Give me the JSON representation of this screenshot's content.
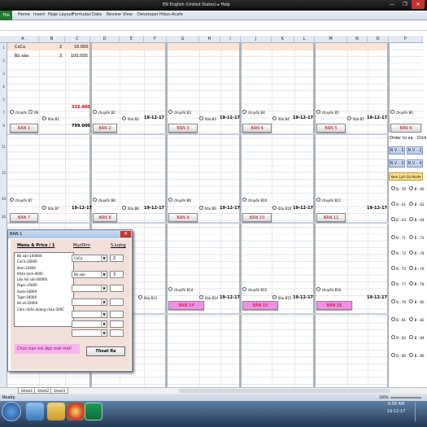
{
  "window": {
    "title": "EN English (United States) ▸ Help",
    "min": "—",
    "max": "❐",
    "close": "✕"
  },
  "ribbon": {
    "file": "File",
    "tabs": [
      "Home",
      "Insert",
      "Page Layout",
      "Formulas",
      "Data",
      "Review",
      "View",
      "Developer",
      "Hduo-Acafe"
    ]
  },
  "columns": [
    "A",
    "B",
    "C",
    "D",
    "E",
    "F",
    "G",
    "H",
    "I",
    "J",
    "K",
    "L",
    "M",
    "N",
    "O",
    "P"
  ],
  "cells": {
    "r1": {
      "a": "CoCa",
      "b": "2",
      "c": "16.000"
    },
    "r2": {
      "a": "Bò xào",
      "b": "3",
      "c": "100.000"
    },
    "total_red": "332.000",
    "total": "799.000"
  },
  "tables": {
    "row1": [
      {
        "label": "BÀN 1",
        "radio": "chuyển",
        "radio2": "Xóa B1",
        "date": "19-12-17"
      },
      {
        "label": "BÀN 2",
        "radio": "chuyển B2",
        "radio2": "Xóa B2",
        "date": "19-12-17"
      },
      {
        "label": "BÀN 3",
        "radio": "chuyển B3",
        "radio2": "Xóa B3",
        "date": "19-12-17"
      },
      {
        "label": "BÀN 4",
        "radio": "chuyển B4",
        "radio2": "Xóa B4",
        "date": "19-12-17"
      },
      {
        "label": "BÀN 5",
        "radio": "chuyển B5",
        "radio2": "Xóa B5",
        "date": "19-12-17"
      },
      {
        "label": "BÀN 6",
        "radio": "chuyển B6",
        "radio2": "",
        "date": ""
      }
    ],
    "row2": [
      {
        "label": "BÀN 7",
        "radio": "chuyển B7",
        "radio2": "Xóa B7",
        "date": "19-12-17"
      },
      {
        "label": "BÀN 8",
        "radio": "chuyển B8",
        "radio2": "Xóa B8",
        "date": "19-12-17"
      },
      {
        "label": "BÀN 9",
        "radio": "chuyển B9",
        "radio2": "Xóa B9",
        "date": "19-12-17"
      },
      {
        "label": "BÀN 10",
        "radio": "chuyển B10",
        "radio2": "Xóa B10",
        "date": "19-12-17"
      },
      {
        "label": "BÀN 11",
        "radio": "chuyển B11",
        "radio2": "",
        "date": "19-12-17"
      }
    ],
    "row3": [
      {
        "label": "BÀN 14",
        "radio": "chuyển B14",
        "radio2": "Xóa B14",
        "date": "19-12-17"
      },
      {
        "label": "BÀN 15",
        "radio": "chuyển B15",
        "radio2": "Xóa B15",
        "date": "19-12-17"
      },
      {
        "label": "BÀN 16",
        "radio": "chuyển B16",
        "radio2": "",
        "date": "19-12-17"
      }
    ],
    "row3_b12_radio": "Xóa B12"
  },
  "rpanel": {
    "title": "Order từ xa - Click",
    "nv": [
      "N V - 1",
      "N V - 2",
      "N V - 3",
      "N V - 4"
    ],
    "history": "Xem Lịch Sử Akafe",
    "b_left": [
      "B - 59",
      "B - 61",
      "B - 63",
      "B - 71",
      "B - 73",
      "B - 75",
      "B - 77",
      "B - 79",
      "B - 81",
      "B - 83",
      "B - 85"
    ],
    "b_right": [
      "B - 60",
      "B - 62",
      "B - 64",
      "B - 72",
      "B - 74",
      "B - 76",
      "B - 78",
      "B - 80",
      "B - 82",
      "B - 84",
      "B - 86"
    ]
  },
  "dialog": {
    "title": "BÀN 1",
    "close": "✕",
    "menu_header": "Menu & Price / 1",
    "mucdm_header": "MụcĐtm",
    "qty_header": "S.lượng",
    "menu": [
      "Bò xào-100000",
      "CoCa-16000",
      "Kem-22000",
      "Khăn lạnh-4000",
      "Lẩu hải sản-60000",
      "Pepsi-15000",
      "Soda-18000",
      "Tiger-18000",
      "bò xé-20000",
      "Cơm chiên dương châu-300C"
    ],
    "combos": [
      "CoCa",
      "Bò xào",
      "",
      "",
      "",
      "",
      ""
    ],
    "qtys": [
      "2",
      "3",
      "",
      "",
      "",
      "",
      ""
    ],
    "slogan": "Chúc bạn trẻ đẹp mãi mãi!",
    "exit": "Thoát Ra"
  },
  "sheets": [
    "Sheet1",
    "Sheet2",
    "Sheet3"
  ],
  "status": {
    "ready": "Ready",
    "zoom": "100%"
  },
  "clock": {
    "time": "9:58 AM",
    "date": "19-12-17"
  }
}
